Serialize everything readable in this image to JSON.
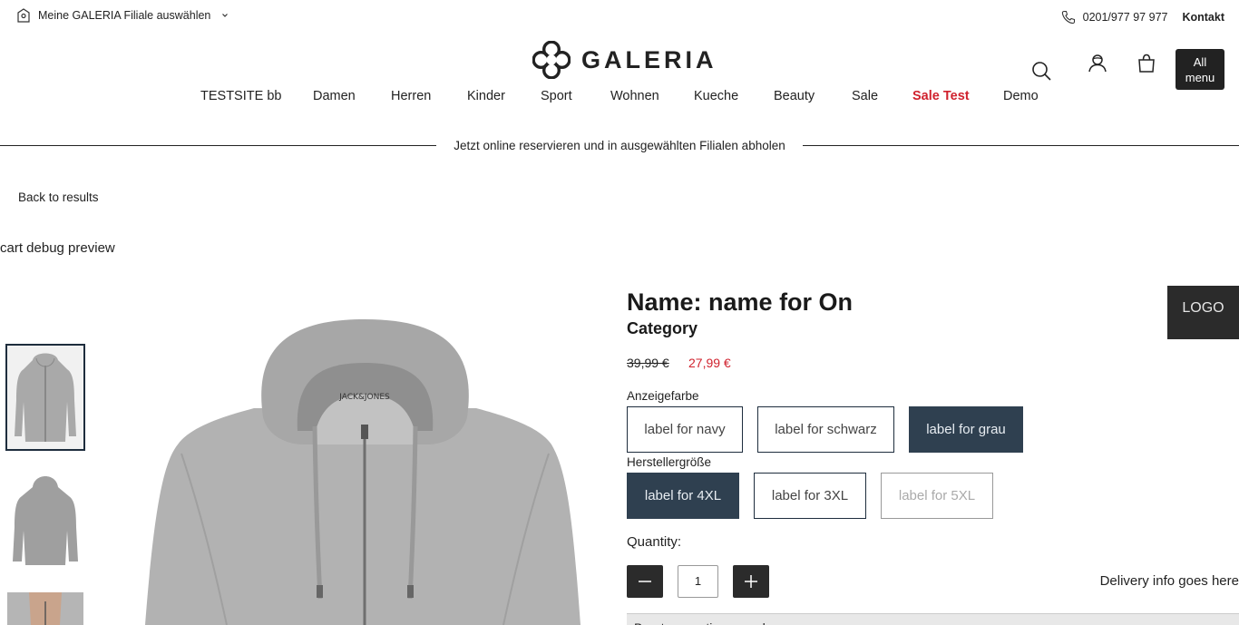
{
  "topbar": {
    "store_label": "Meine GALERIA Filiale auswählen",
    "phone": "0201/977 97 977",
    "contact_label": "Kontakt"
  },
  "brand": {
    "name": "GALERIA"
  },
  "header": {
    "all_menu_line1": "All",
    "all_menu_line2": "menu"
  },
  "icons": {
    "store": "store-pin-icon",
    "chevron": "chevron-down-icon",
    "phone": "phone-icon",
    "search": "search-icon",
    "account": "account-icon",
    "cart": "shopping-bag-icon",
    "minus": "minus-icon",
    "plus": "plus-icon"
  },
  "nav": {
    "items": [
      {
        "label": "TESTSITE bb"
      },
      {
        "label": "Damen"
      },
      {
        "label": "Herren"
      },
      {
        "label": "Kinder"
      },
      {
        "label": "Sport"
      },
      {
        "label": "Wohnen"
      },
      {
        "label": "Kueche"
      },
      {
        "label": "Beauty"
      },
      {
        "label": "Sale"
      },
      {
        "label": "Sale Test"
      },
      {
        "label": "Demo"
      }
    ],
    "highlight_color": "#d0222e"
  },
  "banner": {
    "reserve_text": "Jetzt online reservieren und in ausgewählten Filialen abholen"
  },
  "page": {
    "back_label": "Back to results",
    "debug_title": "cart debug preview"
  },
  "product": {
    "name": "Name: name for On",
    "category": "Category",
    "old_price": "39,99 €",
    "new_price": "27,99 €",
    "color_label": "Anzeigefarbe",
    "colors": [
      {
        "label": "label for navy",
        "state": "default"
      },
      {
        "label": "label for schwarz",
        "state": "default"
      },
      {
        "label": "label for grau",
        "state": "selected"
      }
    ],
    "size_label": "Herstellergröße",
    "sizes": [
      {
        "label": "label for 4XL",
        "state": "selected"
      },
      {
        "label": "label for 3XL",
        "state": "default"
      },
      {
        "label": "label for 5XL",
        "state": "disabled"
      }
    ],
    "quantity_label": "Quantity:",
    "quantity": "1",
    "delivery_info": "Delivery info goes here",
    "accordion_label": "Beratungsoptionen und",
    "logo_placeholder": "LOGO"
  },
  "gallery": {
    "thumbnail_count": 3,
    "active_index": 0
  },
  "colors": {
    "accent_dark": "#2f4050",
    "sale_red": "#d0222e"
  }
}
